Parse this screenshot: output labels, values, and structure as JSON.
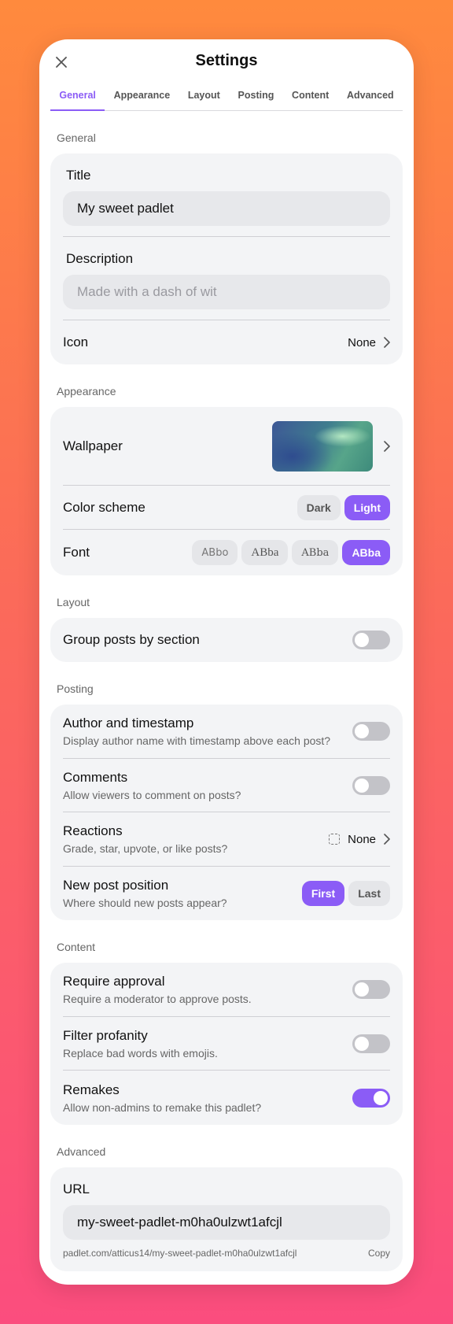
{
  "header": {
    "title": "Settings"
  },
  "tabs": [
    "General",
    "Appearance",
    "Layout",
    "Posting",
    "Content",
    "Advanced"
  ],
  "general": {
    "section_label": "General",
    "title_label": "Title",
    "title_value": "My sweet padlet",
    "description_label": "Description",
    "description_placeholder": "Made with a dash of wit",
    "icon_label": "Icon",
    "icon_value": "None"
  },
  "appearance": {
    "section_label": "Appearance",
    "wallpaper_label": "Wallpaper",
    "color_scheme_label": "Color scheme",
    "color_scheme_options": [
      "Dark",
      "Light"
    ],
    "color_scheme_selected": "Light",
    "font_label": "Font",
    "font_options": [
      "ABbo",
      "ABba",
      "ABba",
      "ABba"
    ],
    "font_selected_index": 3
  },
  "layout": {
    "section_label": "Layout",
    "group_label": "Group posts by section",
    "group_on": false
  },
  "posting": {
    "section_label": "Posting",
    "author_label": "Author and timestamp",
    "author_sub": "Display author name with timestamp above each post?",
    "author_on": false,
    "comments_label": "Comments",
    "comments_sub": "Allow viewers to comment on posts?",
    "comments_on": false,
    "reactions_label": "Reactions",
    "reactions_sub": "Grade, star, upvote, or like posts?",
    "reactions_value": "None",
    "new_post_label": "New post position",
    "new_post_sub": "Where should new posts appear?",
    "new_post_options": [
      "First",
      "Last"
    ],
    "new_post_selected": "First"
  },
  "content": {
    "section_label": "Content",
    "approval_label": "Require approval",
    "approval_sub": "Require a moderator to approve posts.",
    "approval_on": false,
    "profanity_label": "Filter profanity",
    "profanity_sub": "Replace bad words with emojis.",
    "profanity_on": false,
    "remakes_label": "Remakes",
    "remakes_sub": "Allow non-admins to remake this padlet?",
    "remakes_on": true
  },
  "advanced": {
    "section_label": "Advanced",
    "url_label": "URL",
    "url_value": "my-sweet-padlet-m0ha0ulzwt1afcjl",
    "full_url": "padlet.com/atticus14/my-sweet-padlet-m0ha0ulzwt1afcjl",
    "copy_label": "Copy"
  },
  "colors": {
    "accent": "#8b5cf6",
    "card_bg": "#f3f4f6",
    "input_bg": "#e7e8eb"
  }
}
